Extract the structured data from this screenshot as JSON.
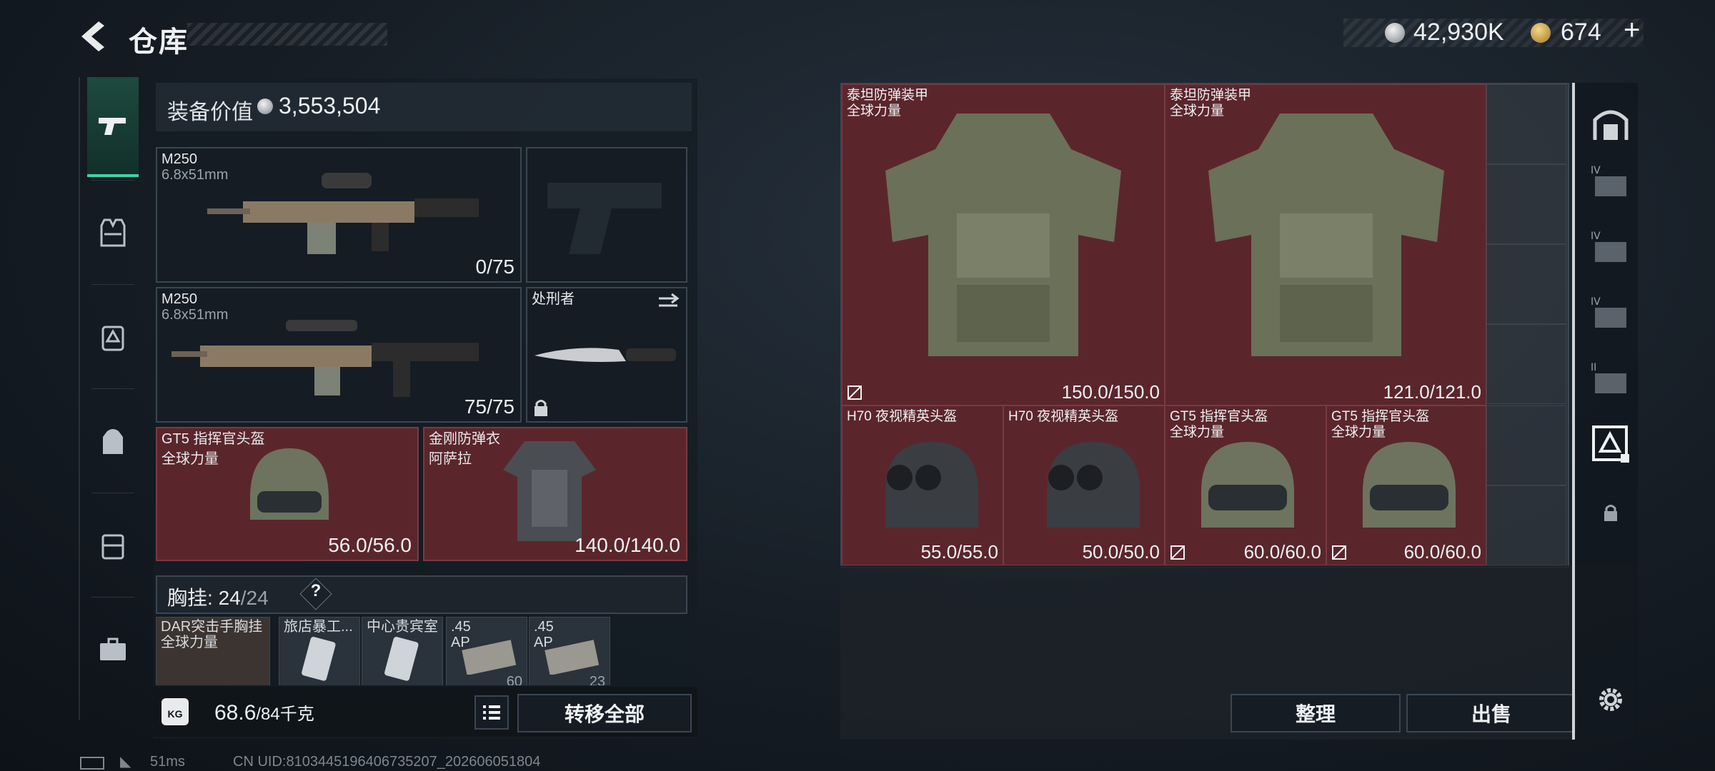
{
  "header": {
    "title": "仓库",
    "currency_silver": "42,930K",
    "currency_gold": "674",
    "plus": "+"
  },
  "rail": {
    "items": [
      "pistol-icon",
      "vest-icon",
      "backpack-tier-icon",
      "backpack-icon",
      "case-icon",
      "toolbox-icon"
    ]
  },
  "loadout": {
    "value_label": "装备价值",
    "value": "3,553,504",
    "primary1": {
      "name": "M250",
      "caliber": "6.8x51mm",
      "ammo": "0/75"
    },
    "primary2": {
      "name": "M250",
      "caliber": "6.8x51mm",
      "ammo": "75/75"
    },
    "melee": {
      "name": "处刑者"
    },
    "helmet": {
      "name": "GT5 指挥官头盔",
      "sub": "全球力量",
      "durability": "56.0/56.0"
    },
    "armor": {
      "name": "金刚防弹衣",
      "sub": "阿萨拉",
      "durability": "140.0/140.0"
    },
    "chest": {
      "label": "胸挂:",
      "current": "24",
      "max": "/24",
      "help": "?"
    },
    "chest_items": [
      {
        "label": "DAR突击手胸挂",
        "sub": "全球力量",
        "count": ""
      },
      {
        "label": "旅店暴工...",
        "sub": "",
        "count": ""
      },
      {
        "label": "中心贵宾室",
        "sub": "",
        "count": ""
      },
      {
        "label": ".45",
        "sub": "AP",
        "count": "60"
      },
      {
        "label": ".45",
        "sub": "AP",
        "count": "23"
      }
    ],
    "weight_value": "68.6",
    "weight_max": "/84千克",
    "kg": "KG",
    "transfer_all": "转移全部"
  },
  "storage": {
    "items": [
      {
        "name": "泰坦防弹装甲",
        "sub": "全球力量",
        "durability": "150.0/150.0",
        "tag": true
      },
      {
        "name": "泰坦防弹装甲",
        "sub": "全球力量",
        "durability": "121.0/121.0",
        "tag": false
      },
      {
        "name": "H70 夜视精英头盔",
        "sub": "",
        "durability": "55.0/55.0",
        "tag": false
      },
      {
        "name": "H70 夜视精英头盔",
        "sub": "",
        "durability": "50.0/50.0",
        "tag": false
      },
      {
        "name": "GT5 指挥官头盔",
        "sub": "全球力量",
        "durability": "60.0/60.0",
        "tag": true
      },
      {
        "name": "GT5 指挥官头盔",
        "sub": "全球力量",
        "durability": "60.0/60.0",
        "tag": true
      }
    ],
    "sort": "整理",
    "sell": "出售"
  },
  "right_rail": [
    "safe-box-icon",
    "container-iv-icon",
    "container-iv-icon",
    "container-iv-icon",
    "container-ii-icon",
    "container-selected-icon",
    "lock-icon",
    "gear-icon"
  ],
  "footer": {
    "ping": "51ms",
    "uid": "CN UID:8103445196406735207_202606051804"
  },
  "colors": {
    "item_bg": "#5a262c",
    "accent": "#3fd3a3"
  }
}
